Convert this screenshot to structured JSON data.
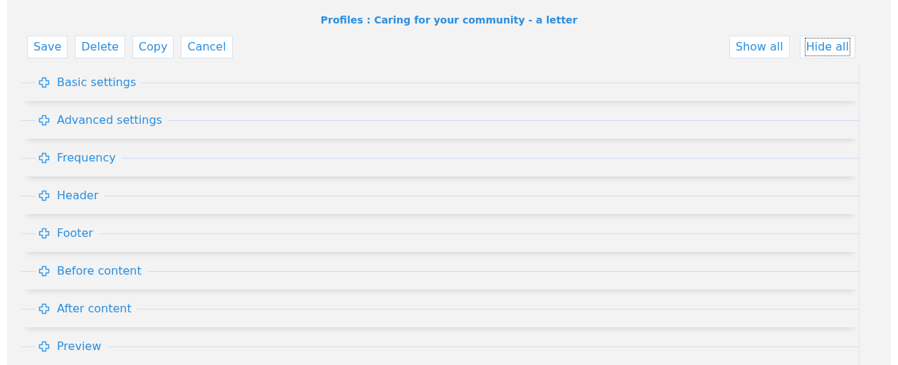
{
  "title": "Profiles : Caring for your community - a letter",
  "toolbar_left": [
    {
      "label": "Save",
      "focused": false
    },
    {
      "label": "Delete",
      "focused": false
    },
    {
      "label": "Copy",
      "focused": false
    },
    {
      "label": "Cancel",
      "focused": false
    }
  ],
  "toolbar_right": [
    {
      "label": "Show all",
      "focused": false
    },
    {
      "label": "Hide all",
      "focused": true
    }
  ],
  "sections": [
    {
      "label": "Basic settings",
      "expanded": false
    },
    {
      "label": "Advanced settings",
      "expanded": false
    },
    {
      "label": "Frequency",
      "expanded": false
    },
    {
      "label": "Header",
      "expanded": false
    },
    {
      "label": "Footer",
      "expanded": false
    },
    {
      "label": "Before content",
      "expanded": false
    },
    {
      "label": "After content",
      "expanded": false
    },
    {
      "label": "Preview",
      "expanded": false
    }
  ]
}
